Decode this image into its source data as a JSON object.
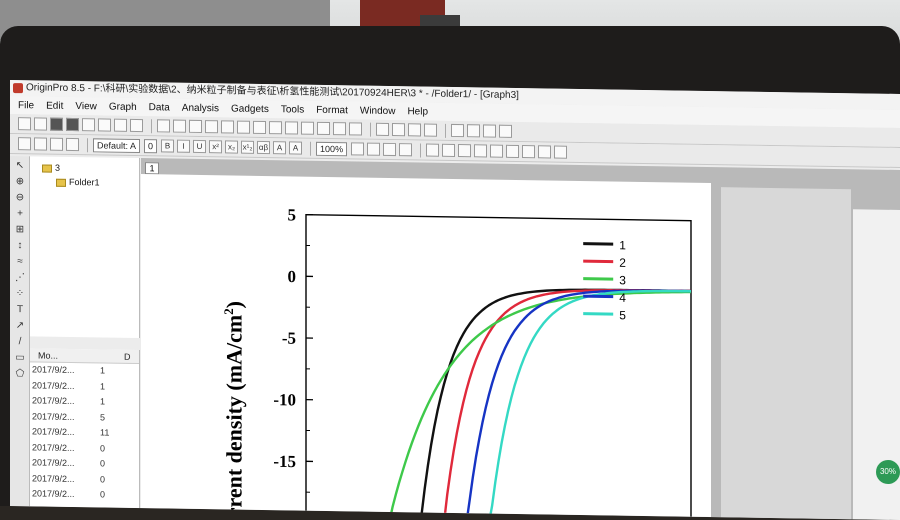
{
  "window": {
    "title": "OriginPro 8.5 - F:\\科研\\实验数据\\2、纳米粒子制备与表征\\析氢性能测试\\20170924HER\\3 * - /Folder1/ - [Graph3]"
  },
  "menu": [
    "File",
    "Edit",
    "View",
    "Graph",
    "Data",
    "Analysis",
    "Gadgets",
    "Tools",
    "Format",
    "Window",
    "Help"
  ],
  "toolbar": {
    "zoom_value": "100%",
    "font_name": "Default: A",
    "font_size": "0",
    "format_labels": [
      "B",
      "I",
      "U",
      "x²",
      "x₂",
      "x¹₂",
      "αβ",
      "A",
      "A"
    ]
  },
  "explorer": {
    "root": "3",
    "folder": "Folder1"
  },
  "filelist": {
    "col_modified": "Mo...",
    "col_d": "D",
    "rows": [
      {
        "date": "2017/9/2...",
        "d": "1"
      },
      {
        "date": "2017/9/2...",
        "d": "1"
      },
      {
        "date": "2017/9/2...",
        "d": "1"
      },
      {
        "date": "2017/9/2...",
        "d": "5"
      },
      {
        "date": "2017/9/2...",
        "d": "11"
      },
      {
        "date": "2017/9/2...",
        "d": "0"
      },
      {
        "date": "2017/9/2...",
        "d": "0"
      },
      {
        "date": "2017/9/2...",
        "d": "0"
      },
      {
        "date": "2017/9/2...",
        "d": "0"
      }
    ]
  },
  "graph_tab": "1",
  "badge": "30%",
  "chart_data": {
    "type": "line",
    "ylabel": "urrent density (mA/cm2)",
    "ylabel_main": "urrent density (mA/cm",
    "ylabel_sup": "2",
    "ylabel_close": ")",
    "ylim": [
      -19,
      5
    ],
    "xlim": [
      0,
      1
    ],
    "yticks": [
      "5",
      "0",
      "-5",
      "-10",
      "-15"
    ],
    "ytick_values": [
      5,
      0,
      -5,
      -10,
      -15
    ],
    "legend": "top-right",
    "series": [
      {
        "name": "1",
        "color": "#111111",
        "onset": 0.3,
        "steep": 0.075
      },
      {
        "name": "2",
        "color": "#e0293b",
        "onset": 0.36,
        "steep": 0.078
      },
      {
        "name": "3",
        "color": "#3ec94a",
        "onset": 0.22,
        "steep": 0.16
      },
      {
        "name": "4",
        "color": "#1634c4",
        "onset": 0.42,
        "steep": 0.08
      },
      {
        "name": "5",
        "color": "#34d9c4",
        "onset": 0.48,
        "steep": 0.08
      }
    ]
  }
}
